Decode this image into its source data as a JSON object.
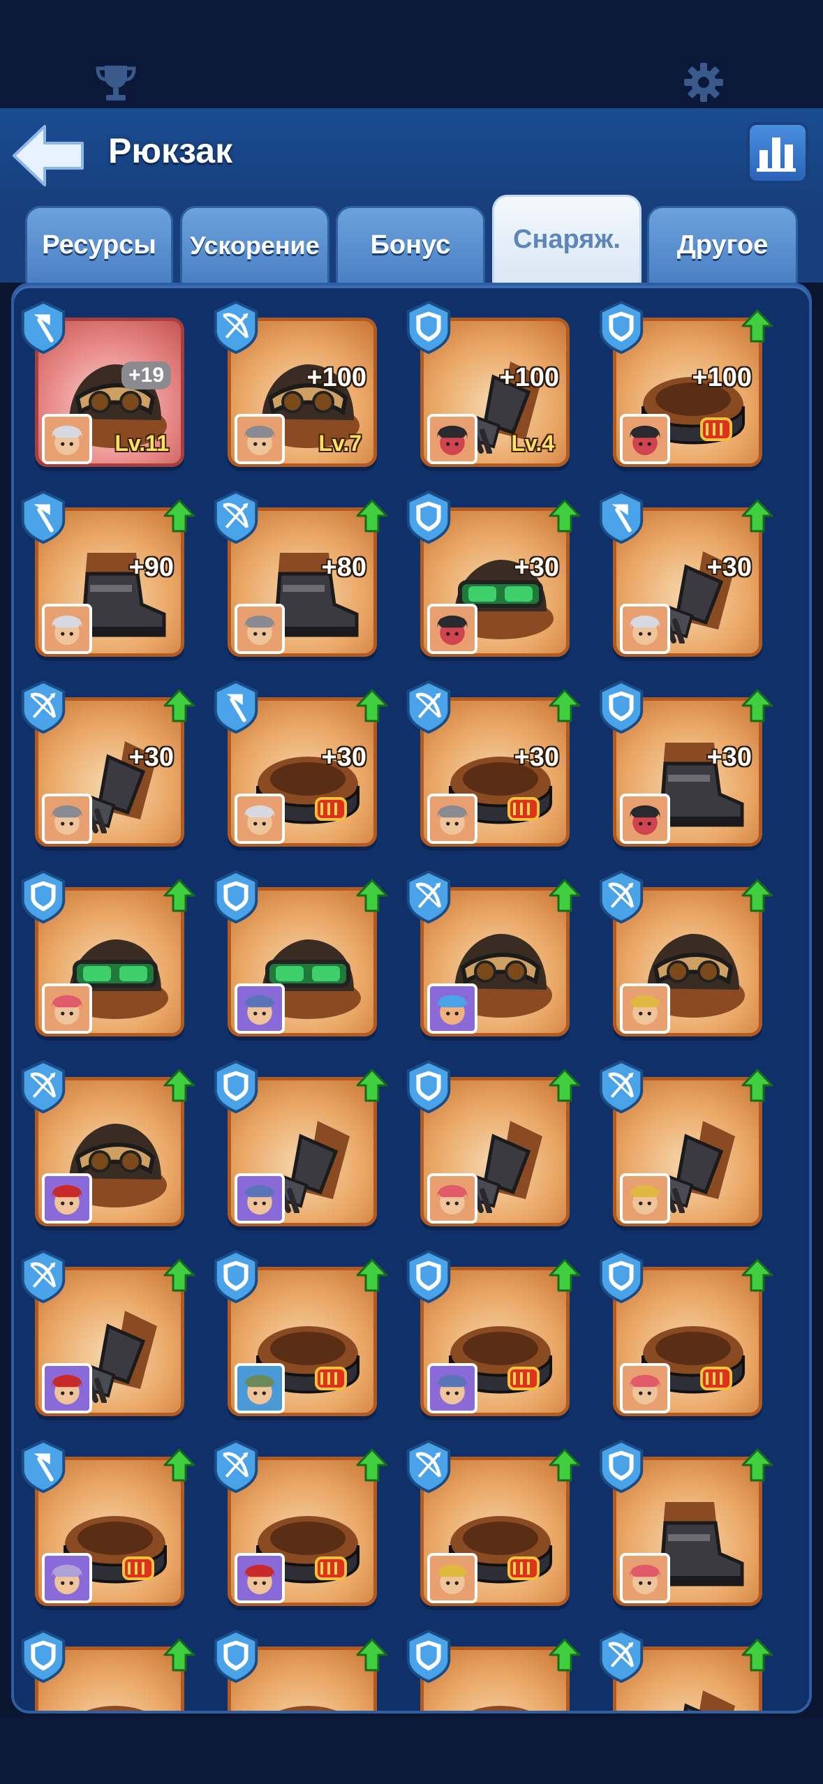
{
  "header": {
    "title": "Рюкзак"
  },
  "tabs": [
    {
      "label": "Ресурсы",
      "active": false
    },
    {
      "label": "Ускорение",
      "active": false
    },
    {
      "label": "Бонус",
      "active": false
    },
    {
      "label": "Снаряж.",
      "active": true
    },
    {
      "label": "Другое",
      "active": false
    }
  ],
  "items": [
    {
      "type": "spear",
      "piece": "helmet",
      "bonus": "+19",
      "bonus_style": "gray",
      "level": "Lv.11",
      "upgrade": false,
      "hero": "white-hair",
      "rarity": "red"
    },
    {
      "type": "bow",
      "piece": "helmet",
      "bonus": "+100",
      "level": "Lv.7",
      "upgrade": false,
      "hero": "bearded"
    },
    {
      "type": "shield",
      "piece": "glove",
      "bonus": "+100",
      "level": "Lv.4",
      "upgrade": false,
      "hero": "knight"
    },
    {
      "type": "shield",
      "piece": "belt",
      "bonus": "+100",
      "upgrade": true,
      "hero": "knight"
    },
    {
      "type": "spear",
      "piece": "boot",
      "bonus": "+90",
      "upgrade": true,
      "hero": "white-hair"
    },
    {
      "type": "bow",
      "piece": "boot",
      "bonus": "+80",
      "upgrade": true,
      "hero": "bearded"
    },
    {
      "type": "shield",
      "piece": "goggles",
      "bonus": "+30",
      "upgrade": true,
      "hero": "knight"
    },
    {
      "type": "spear",
      "piece": "glove",
      "bonus": "+30",
      "upgrade": true,
      "hero": "white-hair"
    },
    {
      "type": "bow",
      "piece": "glove",
      "bonus": "+30",
      "upgrade": true,
      "hero": "bearded"
    },
    {
      "type": "spear",
      "piece": "belt",
      "bonus": "+30",
      "upgrade": true,
      "hero": "white-hair"
    },
    {
      "type": "bow",
      "piece": "belt",
      "bonus": "+30",
      "upgrade": true,
      "hero": "bearded"
    },
    {
      "type": "shield",
      "piece": "boot",
      "bonus": "+30",
      "upgrade": true,
      "hero": "knight"
    },
    {
      "type": "shield",
      "piece": "goggles",
      "upgrade": true,
      "hero": "pink-hat"
    },
    {
      "type": "shield",
      "piece": "goggles",
      "upgrade": true,
      "hero": "dwarf"
    },
    {
      "type": "bow",
      "piece": "helmet",
      "upgrade": true,
      "hero": "goggles-man"
    },
    {
      "type": "bow",
      "piece": "helmet",
      "upgrade": true,
      "hero": "miner"
    },
    {
      "type": "bow",
      "piece": "helmet",
      "upgrade": true,
      "hero": "red-hair"
    },
    {
      "type": "shield",
      "piece": "glove",
      "upgrade": true,
      "hero": "dwarf"
    },
    {
      "type": "shield",
      "piece": "glove",
      "upgrade": true,
      "hero": "pink-hat"
    },
    {
      "type": "bow",
      "piece": "glove",
      "upgrade": true,
      "hero": "miner"
    },
    {
      "type": "bow",
      "piece": "glove",
      "upgrade": true,
      "hero": "red-hair"
    },
    {
      "type": "shield",
      "piece": "belt",
      "upgrade": true,
      "hero": "soldier"
    },
    {
      "type": "shield",
      "piece": "belt",
      "upgrade": true,
      "hero": "dwarf"
    },
    {
      "type": "shield",
      "piece": "belt",
      "upgrade": true,
      "hero": "pink-hat"
    },
    {
      "type": "spear",
      "piece": "belt",
      "upgrade": true,
      "hero": "cow"
    },
    {
      "type": "bow",
      "piece": "belt",
      "upgrade": true,
      "hero": "red-hair"
    },
    {
      "type": "bow",
      "piece": "belt",
      "upgrade": true,
      "hero": "miner"
    },
    {
      "type": "shield",
      "piece": "boot",
      "upgrade": true,
      "hero": "pink-hat"
    },
    {
      "type": "shield",
      "piece": "belt",
      "upgrade": true,
      "hero": ""
    },
    {
      "type": "shield",
      "piece": "belt",
      "upgrade": true,
      "hero": ""
    },
    {
      "type": "shield",
      "piece": "belt",
      "upgrade": true,
      "hero": ""
    },
    {
      "type": "bow",
      "piece": "glove",
      "upgrade": true,
      "hero": ""
    }
  ],
  "colors": {
    "header_bg": "#1a4c92",
    "panel_bg": "#10306a",
    "card_orange": "#eaa766",
    "card_red": "#e88a88",
    "upgrade_green": "#3fcf3f",
    "level_yellow": "#ffe066"
  },
  "icons": {
    "top_left": "trophy-icon",
    "top_right": "gear-icon",
    "back": "back-arrow-icon",
    "stats": "bar-chart-icon"
  }
}
